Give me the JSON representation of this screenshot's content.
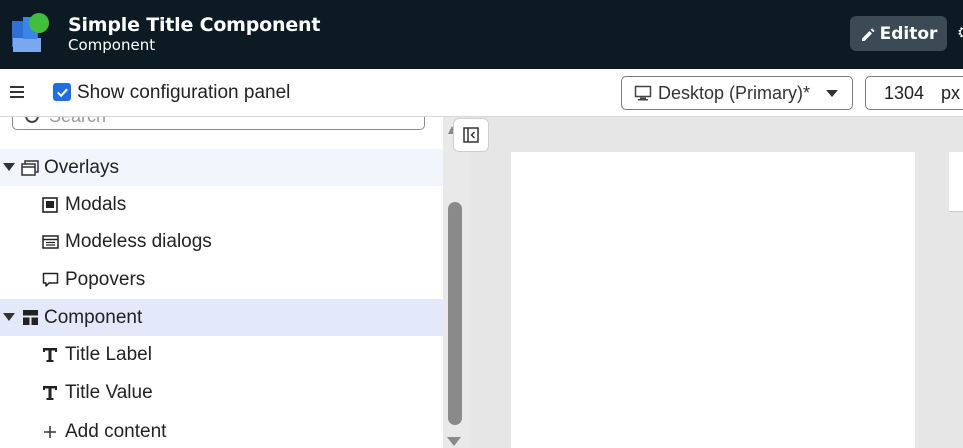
{
  "header": {
    "title": "Simple Title Component",
    "subtitle": "Component",
    "editor_label": "Editor",
    "colors": {
      "background": "#0c1a24",
      "editor_button": "#3b4a55"
    }
  },
  "toolbar": {
    "show_config_label": "Show configuration panel",
    "show_config_checked": true,
    "device_label": "Desktop (Primary)*",
    "width_value": "1304",
    "width_unit": "px"
  },
  "search": {
    "placeholder": "Search"
  },
  "tree": {
    "overlays": {
      "label": "Overlays",
      "children": [
        {
          "label": "Modals",
          "icon": "modal-icon"
        },
        {
          "label": "Modeless dialogs",
          "icon": "modeless-dialog-icon"
        },
        {
          "label": "Popovers",
          "icon": "popover-icon"
        }
      ]
    },
    "component": {
      "label": "Component",
      "children": [
        {
          "label": "Title Label",
          "icon": "text-icon"
        },
        {
          "label": "Title Value",
          "icon": "text-icon"
        }
      ]
    },
    "add_content_label": "Add content"
  },
  "accent": "#1d6fe8"
}
